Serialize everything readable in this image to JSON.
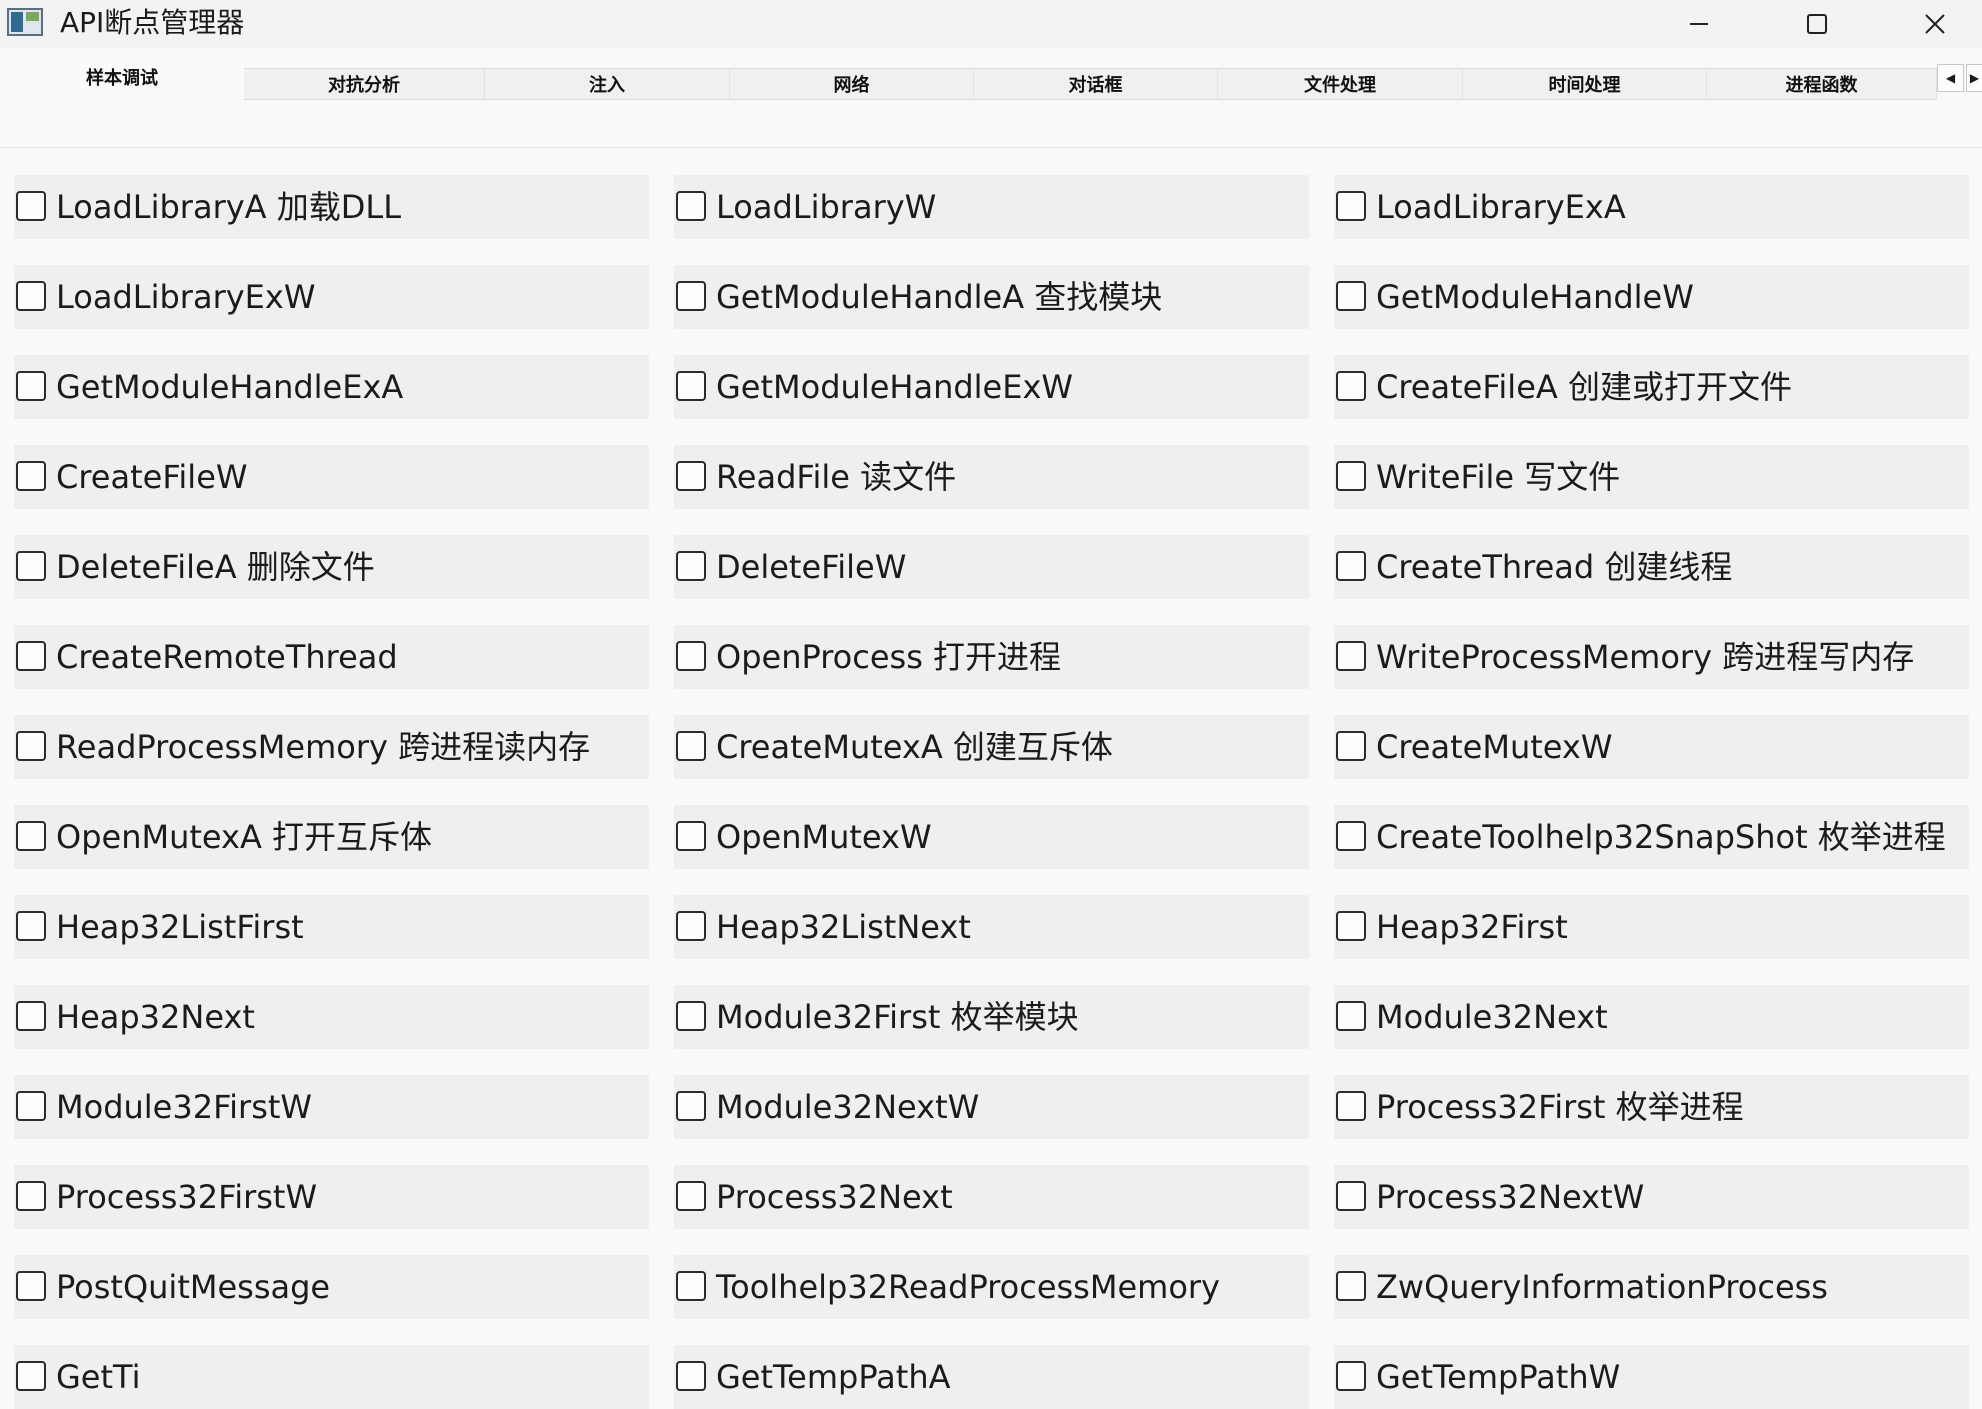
{
  "window": {
    "title": "API断点管理器",
    "controls": [
      "minimize-icon",
      "maximize-icon",
      "close-icon"
    ]
  },
  "tabs": [
    {
      "label": "样本调试",
      "active": true
    },
    {
      "label": "对抗分析",
      "active": false
    },
    {
      "label": "注入",
      "active": false
    },
    {
      "label": "网络",
      "active": false
    },
    {
      "label": "对话框",
      "active": false
    },
    {
      "label": "文件处理",
      "active": false
    },
    {
      "label": "时间处理",
      "active": false
    },
    {
      "label": "进程函数",
      "active": false
    }
  ],
  "tab_scroll": {
    "left": "◀",
    "right": "▶"
  },
  "items": [
    {
      "label": "LoadLibraryA  加载DLL",
      "checked": false
    },
    {
      "label": "LoadLibraryW",
      "checked": false
    },
    {
      "label": "LoadLibraryExA",
      "checked": false
    },
    {
      "label": "LoadLibraryExW",
      "checked": false
    },
    {
      "label": "GetModuleHandleA  查找模块",
      "checked": false
    },
    {
      "label": "GetModuleHandleW",
      "checked": false
    },
    {
      "label": "GetModuleHandleExA",
      "checked": false
    },
    {
      "label": "GetModuleHandleExW",
      "checked": false
    },
    {
      "label": "CreateFileA  创建或打开文件",
      "checked": false
    },
    {
      "label": "CreateFileW",
      "checked": false
    },
    {
      "label": "ReadFile  读文件",
      "checked": false
    },
    {
      "label": "WriteFile  写文件",
      "checked": false
    },
    {
      "label": "DeleteFileA  删除文件",
      "checked": false
    },
    {
      "label": "DeleteFileW",
      "checked": false
    },
    {
      "label": "CreateThread  创建线程",
      "checked": false
    },
    {
      "label": "CreateRemoteThread",
      "checked": false
    },
    {
      "label": "OpenProcess  打开进程",
      "checked": false
    },
    {
      "label": "WriteProcessMemory  跨进程写内存",
      "checked": false
    },
    {
      "label": "ReadProcessMemory  跨进程读内存",
      "checked": false
    },
    {
      "label": "CreateMutexA  创建互斥体",
      "checked": false
    },
    {
      "label": "CreateMutexW",
      "checked": false
    },
    {
      "label": "OpenMutexA  打开互斥体",
      "checked": false
    },
    {
      "label": "OpenMutexW",
      "checked": false
    },
    {
      "label": "CreateToolhelp32SnapShot  枚举进程",
      "checked": false
    },
    {
      "label": "Heap32ListFirst",
      "checked": false
    },
    {
      "label": "Heap32ListNext",
      "checked": false
    },
    {
      "label": "Heap32First",
      "checked": false
    },
    {
      "label": "Heap32Next",
      "checked": false
    },
    {
      "label": "Module32First  枚举模块",
      "checked": false
    },
    {
      "label": "Module32Next",
      "checked": false
    },
    {
      "label": "Module32FirstW",
      "checked": false
    },
    {
      "label": "Module32NextW",
      "checked": false
    },
    {
      "label": "Process32First  枚举进程",
      "checked": false
    },
    {
      "label": "Process32FirstW",
      "checked": false
    },
    {
      "label": "Process32Next",
      "checked": false
    },
    {
      "label": "Process32NextW",
      "checked": false
    },
    {
      "label": "PostQuitMessage",
      "checked": false
    },
    {
      "label": "Toolhelp32ReadProcessMemory",
      "checked": false
    },
    {
      "label": "ZwQueryInformationProcess",
      "checked": false
    },
    {
      "label": "GetTi",
      "checked": false
    },
    {
      "label": "GetTempPathA",
      "checked": false
    },
    {
      "label": "GetTempPathW",
      "checked": false
    }
  ]
}
